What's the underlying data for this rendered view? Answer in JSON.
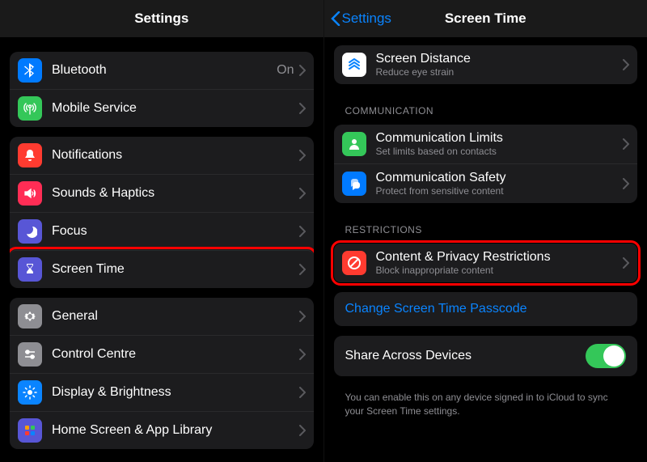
{
  "left": {
    "title": "Settings",
    "groups": [
      {
        "rows": [
          {
            "id": "bluetooth",
            "label": "Bluetooth",
            "value": "On"
          },
          {
            "id": "mobile-service",
            "label": "Mobile Service"
          }
        ]
      },
      {
        "rows": [
          {
            "id": "notifications",
            "label": "Notifications"
          },
          {
            "id": "sounds-haptics",
            "label": "Sounds & Haptics"
          },
          {
            "id": "focus",
            "label": "Focus"
          },
          {
            "id": "screen-time",
            "label": "Screen Time",
            "highlight": true
          }
        ]
      },
      {
        "rows": [
          {
            "id": "general",
            "label": "General"
          },
          {
            "id": "control-centre",
            "label": "Control Centre"
          },
          {
            "id": "display-brightness",
            "label": "Display & Brightness"
          },
          {
            "id": "home-screen",
            "label": "Home Screen & App Library"
          }
        ]
      }
    ]
  },
  "right": {
    "back": "Settings",
    "title": "Screen Time",
    "top_row": {
      "label": "Screen Distance",
      "sub": "Reduce eye strain"
    },
    "sections": [
      {
        "header": "COMMUNICATION",
        "rows": [
          {
            "id": "comm-limits",
            "label": "Communication Limits",
            "sub": "Set limits based on contacts"
          },
          {
            "id": "comm-safety",
            "label": "Communication Safety",
            "sub": "Protect from sensitive content"
          }
        ]
      },
      {
        "header": "RESTRICTIONS",
        "rows": [
          {
            "id": "content-privacy",
            "label": "Content & Privacy Restrictions",
            "sub": "Block inappropriate content",
            "highlight": true
          }
        ]
      }
    ],
    "passcode_link": "Change Screen Time Passcode",
    "share": {
      "label": "Share Across Devices",
      "note": "You can enable this on any device signed in to iCloud to sync your Screen Time settings."
    }
  }
}
